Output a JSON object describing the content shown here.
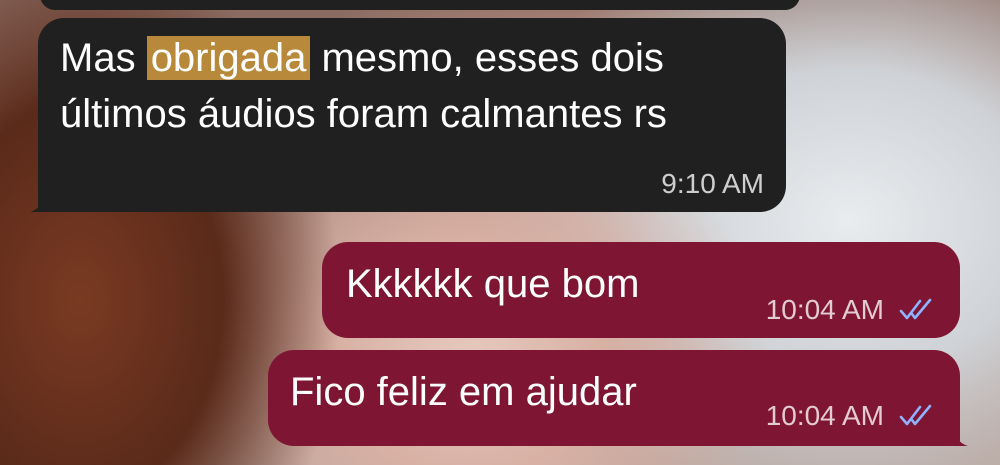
{
  "chat": {
    "messages": [
      {
        "direction": "incoming",
        "text_prefix": "Mas ",
        "highlight": "obrigada",
        "text_suffix": " mesmo, esses dois\núltimos áudios foram calmantes rs",
        "time": "9:10 AM"
      },
      {
        "direction": "outgoing",
        "text": "Kkkkkk que bom",
        "time": "10:04 AM",
        "status": "read"
      },
      {
        "direction": "outgoing",
        "text": "Fico feliz em ajudar",
        "time": "10:04 AM",
        "status": "read"
      }
    ]
  },
  "colors": {
    "incoming_bubble": "#202020",
    "outgoing_bubble": "#7d1533",
    "highlight": "#b8893a",
    "read_ticks": "#8fb4ff"
  },
  "icons": {
    "read_receipt": "double-check-icon"
  }
}
